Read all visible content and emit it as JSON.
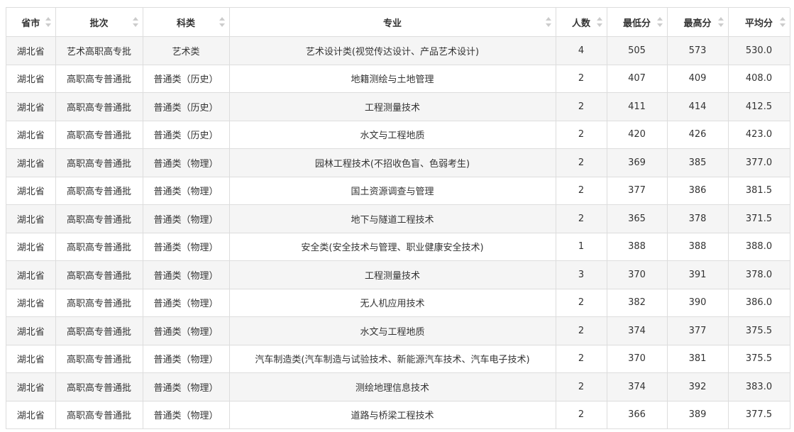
{
  "table": {
    "columns": [
      "省市",
      "批次",
      "科类",
      "专业",
      "人数",
      "最低分",
      "最高分",
      "平均分"
    ],
    "rows": [
      [
        "湖北省",
        "艺术高职高专批",
        "艺术类",
        "艺术设计类(视觉传达设计、产品艺术设计)",
        "4",
        "505",
        "573",
        "530.0"
      ],
      [
        "湖北省",
        "高职高专普通批",
        "普通类（历史）",
        "地籍测绘与土地管理",
        "2",
        "407",
        "409",
        "408.0"
      ],
      [
        "湖北省",
        "高职高专普通批",
        "普通类（历史）",
        "工程测量技术",
        "2",
        "411",
        "414",
        "412.5"
      ],
      [
        "湖北省",
        "高职高专普通批",
        "普通类（历史）",
        "水文与工程地质",
        "2",
        "420",
        "426",
        "423.0"
      ],
      [
        "湖北省",
        "高职高专普通批",
        "普通类（物理）",
        "园林工程技术(不招收色盲、色弱考生)",
        "2",
        "369",
        "385",
        "377.0"
      ],
      [
        "湖北省",
        "高职高专普通批",
        "普通类（物理）",
        "国土资源调查与管理",
        "2",
        "377",
        "386",
        "381.5"
      ],
      [
        "湖北省",
        "高职高专普通批",
        "普通类（物理）",
        "地下与隧道工程技术",
        "2",
        "365",
        "378",
        "371.5"
      ],
      [
        "湖北省",
        "高职高专普通批",
        "普通类（物理）",
        "安全类(安全技术与管理、职业健康安全技术)",
        "1",
        "388",
        "388",
        "388.0"
      ],
      [
        "湖北省",
        "高职高专普通批",
        "普通类（物理）",
        "工程测量技术",
        "3",
        "370",
        "391",
        "378.0"
      ],
      [
        "湖北省",
        "高职高专普通批",
        "普通类（物理）",
        "无人机应用技术",
        "2",
        "382",
        "390",
        "386.0"
      ],
      [
        "湖北省",
        "高职高专普通批",
        "普通类（物理）",
        "水文与工程地质",
        "2",
        "374",
        "377",
        "375.5"
      ],
      [
        "湖北省",
        "高职高专普通批",
        "普通类（物理）",
        "汽车制造类(汽车制造与试验技术、新能源汽车技术、汽车电子技术)",
        "2",
        "370",
        "381",
        "375.5"
      ],
      [
        "湖北省",
        "高职高专普通批",
        "普通类（物理）",
        "测绘地理信息技术",
        "2",
        "374",
        "392",
        "383.0"
      ],
      [
        "湖北省",
        "高职高专普通批",
        "普通类（物理）",
        "道路与桥梁工程技术",
        "2",
        "366",
        "389",
        "377.5"
      ]
    ]
  },
  "icons": {
    "sort": "sort-arrows-icon"
  },
  "colors": {
    "border": "#dddddd",
    "stripe": "#f5f5f5",
    "text": "#333333",
    "sort_arrow": "#cccccc"
  }
}
